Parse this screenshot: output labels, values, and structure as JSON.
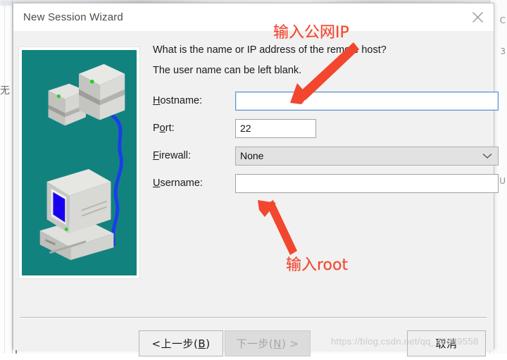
{
  "window": {
    "title": "New Session Wizard",
    "close_icon": "close-icon"
  },
  "content": {
    "prompt_line_1": "What is the name or IP address of the remote host?",
    "prompt_line_2": "The user name can be left blank.",
    "fields": {
      "hostname": {
        "label_prefix": "",
        "label_mnemonic": "H",
        "label_suffix": "ostname:",
        "value": "",
        "placeholder": "",
        "focused": true
      },
      "port": {
        "label_prefix": "P",
        "label_mnemonic": "o",
        "label_suffix": "rt:",
        "value": "22",
        "placeholder": "",
        "focused": false
      },
      "firewall": {
        "label_prefix": "",
        "label_mnemonic": "F",
        "label_suffix": "irewall:",
        "value": "None",
        "chevron_icon": "chevron-down-icon"
      },
      "username": {
        "label_prefix": "",
        "label_mnemonic": "U",
        "label_suffix": "sername:",
        "value": "",
        "placeholder": "",
        "focused": false
      }
    }
  },
  "illustration": {
    "name": "network-hosts-illustration",
    "background_color": "#12827f",
    "cable_color": "#1a3ee8",
    "screen_color": "#1800ef",
    "case_color": "#d4d4d0"
  },
  "footer": {
    "back_prefix": "< ",
    "back_text": "上一步(",
    "back_mnemonic": "B",
    "back_suffix": ")",
    "next_text": "下一步(",
    "next_mnemonic": "N",
    "next_suffix": ") >",
    "next_disabled": true,
    "cancel_label": "取消"
  },
  "annotations": {
    "top": "输入公网IP",
    "bottom": "输入root",
    "color": "#f2462f"
  },
  "watermark": "https://blog.csdn.net/qq_45949558",
  "backdrop": {
    "char_left": "无",
    "char_right_1": "C",
    "char_right_2": "3",
    "char_right_3": "U"
  }
}
